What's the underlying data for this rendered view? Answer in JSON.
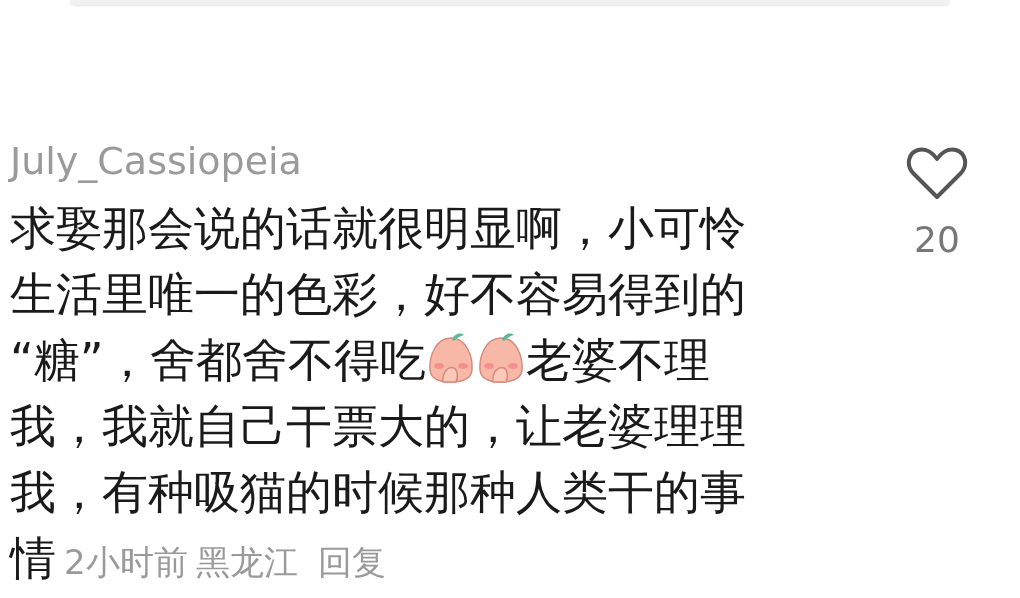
{
  "comment": {
    "username": "July_Cassiopeia",
    "lines": [
      [
        {
          "kind": "text",
          "text": "求娶那会说的话就很明显啊，小可怜"
        }
      ],
      [
        {
          "kind": "text",
          "text": "生活里唯一的色彩，好不容易得到的"
        }
      ],
      [
        {
          "kind": "text",
          "text": "“糖”，舍都舍不得吃"
        },
        {
          "kind": "emoji"
        },
        {
          "kind": "emoji"
        },
        {
          "kind": "text",
          "text": "老婆不理"
        }
      ],
      [
        {
          "kind": "text",
          "text": "我，我就自己干票大的，让老婆理理"
        }
      ],
      [
        {
          "kind": "text",
          "text": "我，有种吸猫的时候那种人类干的事"
        }
      ],
      [
        {
          "kind": "text",
          "text": "情"
        }
      ]
    ],
    "time": "2小时前",
    "location": "黑龙江",
    "reply": "回复",
    "likes": "20",
    "liked": false
  }
}
